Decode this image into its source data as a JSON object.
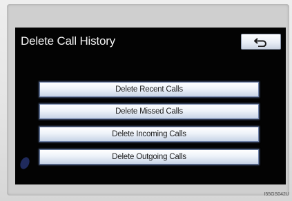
{
  "screen": {
    "title": "Delete Call History",
    "back_icon": "return-arrow-icon",
    "buttons": [
      {
        "label": "Delete Recent Calls"
      },
      {
        "label": "Delete Missed Calls"
      },
      {
        "label": "Delete Incoming Calls"
      },
      {
        "label": "Delete Outgoing Calls"
      }
    ]
  },
  "figure_code": "I55GS042U",
  "colors": {
    "screen_bg": "#030303",
    "button_gradient_top": "#ffffff",
    "button_gradient_bottom": "#c7d3e6",
    "button_border": "#6f82a8"
  }
}
